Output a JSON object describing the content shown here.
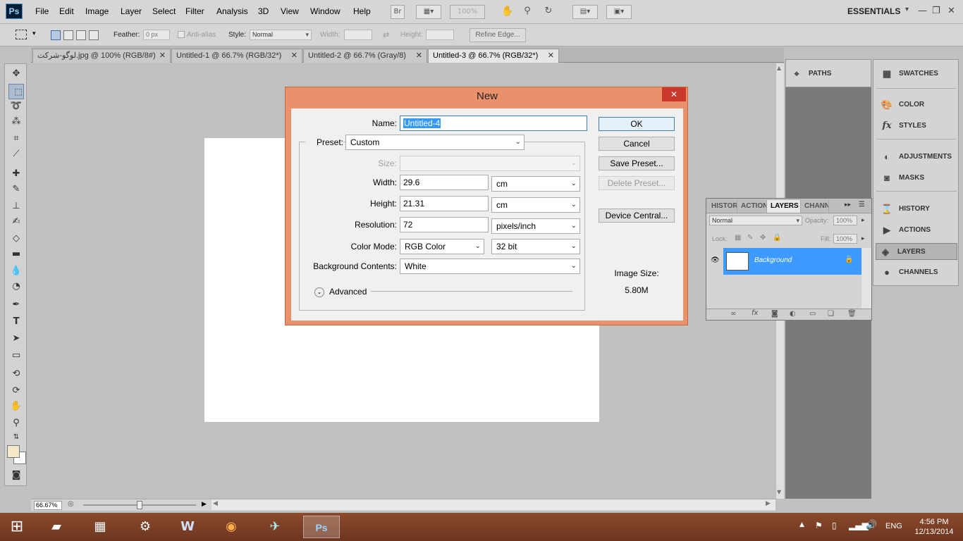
{
  "app": {
    "logo": "Ps",
    "menu": [
      "File",
      "Edit",
      "Image",
      "Layer",
      "Select",
      "Filter",
      "Analysis",
      "3D",
      "View",
      "Window",
      "Help"
    ],
    "bridge_label": "Br",
    "zoom": "100%",
    "workspace": "ESSENTIALS",
    "win_min": "—",
    "win_restore": "❐",
    "win_close": "✕"
  },
  "options": {
    "feather_label": "Feather:",
    "feather_value": "0 px",
    "antialias_label": "Anti-alias",
    "style_label": "Style:",
    "style_value": "Normal",
    "width_label": "Width:",
    "height_label": "Height:",
    "refine_edge": "Refine Edge..."
  },
  "tabs": [
    {
      "label": "لوگو-شرکت.jpg @ 100% (RGB/8#)",
      "close": "✕"
    },
    {
      "label": "Untitled-1 @ 66.7% (RGB/32*)",
      "close": "✕"
    },
    {
      "label": "Untitled-2 @ 66.7% (Gray/8)",
      "close": "✕"
    },
    {
      "label": "Untitled-3 @ 66.7% (RGB/32*)",
      "close": "✕"
    }
  ],
  "status": {
    "zoom": "66.67%"
  },
  "dock": {
    "paths": "PATHS",
    "swatches": "SWATCHES",
    "color": "COLOR",
    "styles": "STYLES",
    "adjustments": "ADJUSTMENTS",
    "masks": "MASKS",
    "history": "HISTORY",
    "actions": "ACTIONS",
    "layers": "LAYERS",
    "channels": "CHANNELS"
  },
  "layers_panel": {
    "tabs": [
      "HISTOR",
      "ACTION",
      "LAYERS",
      "CHANN"
    ],
    "blend_mode": "Normal",
    "opacity_label": "Opacity:",
    "opacity_value": "100%",
    "lock_label": "Lock:",
    "fill_label": "Fill:",
    "fill_value": "100%",
    "layer_name": "Background"
  },
  "dialog": {
    "title": "New",
    "close": "✕",
    "name_label": "Name:",
    "name_value": "Untitled-4",
    "preset_label": "Preset:",
    "preset_value": "Custom",
    "size_label": "Size:",
    "width_label": "Width:",
    "width_value": "29.6",
    "width_unit": "cm",
    "height_label": "Height:",
    "height_value": "21.31",
    "height_unit": "cm",
    "resolution_label": "Resolution:",
    "resolution_value": "72",
    "resolution_unit": "pixels/inch",
    "color_mode_label": "Color Mode:",
    "color_mode_value": "RGB Color",
    "bit_depth": "32 bit",
    "bg_label": "Background Contents:",
    "bg_value": "White",
    "advanced_label": "Advanced",
    "ok": "OK",
    "cancel": "Cancel",
    "save_preset": "Save Preset...",
    "delete_preset": "Delete Preset...",
    "device_central": "Device Central...",
    "image_size_label": "Image Size:",
    "image_size_value": "5.80M"
  },
  "taskbar": {
    "language": "ENG",
    "time": "4:56 PM",
    "date": "12/13/2014"
  },
  "colors": {
    "dialog_frame": "#e9916a",
    "layer_selected": "#3d9bff",
    "taskbar": "#7a3f25"
  }
}
